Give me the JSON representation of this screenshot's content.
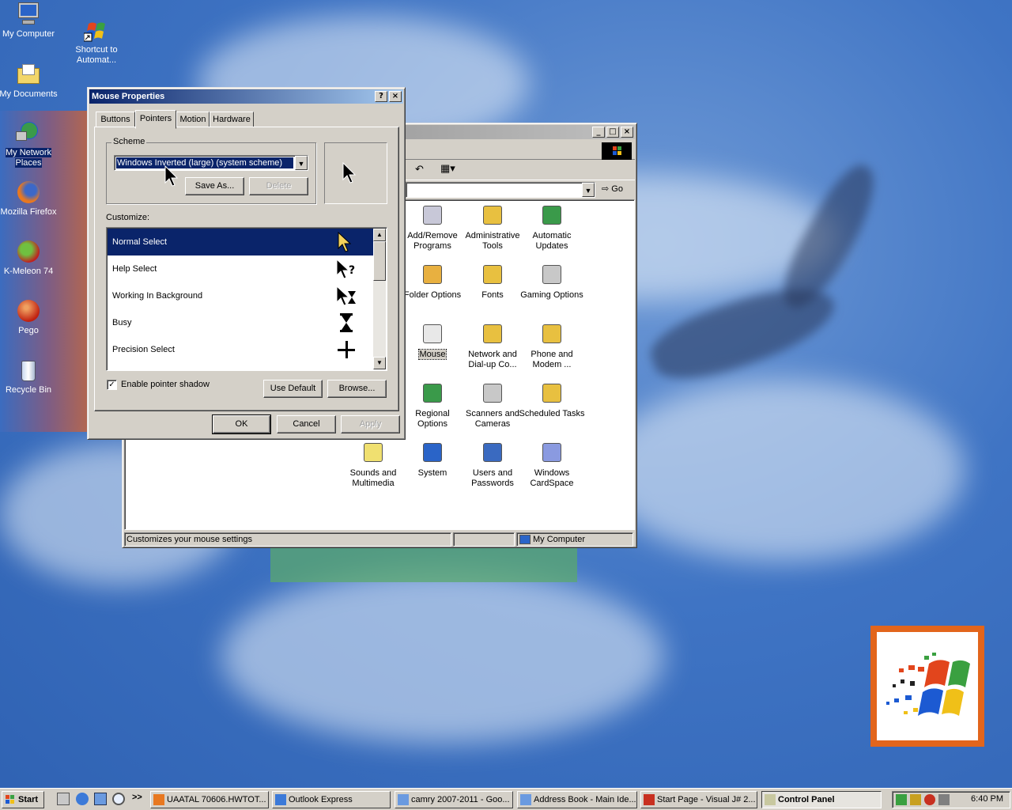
{
  "desktop": {
    "icons": [
      {
        "label": "My Computer",
        "icon": "my-computer-icon"
      },
      {
        "label": "Shortcut to Automat...",
        "icon": "windows-update-shortcut-icon"
      },
      {
        "label": "My Documents",
        "icon": "my-documents-icon"
      },
      {
        "label": "My Network Places",
        "icon": "network-places-icon"
      },
      {
        "label": "Mozilla Firefox",
        "icon": "firefox-icon"
      },
      {
        "label": "K-Meleon 74",
        "icon": "k-meleon-icon"
      },
      {
        "label": "Pego",
        "icon": "pego-icon"
      },
      {
        "label": "Recycle Bin",
        "icon": "recycle-bin-icon"
      }
    ]
  },
  "mouse_dialog": {
    "title": "Mouse Properties",
    "help_btn": "?",
    "close_btn": "×",
    "tabs": [
      "Buttons",
      "Pointers",
      "Motion",
      "Hardware"
    ],
    "active_tab": "Pointers",
    "scheme_label": "Scheme",
    "scheme_value": "Windows Inverted (large) (system scheme)",
    "save_as": "Save As...",
    "delete": "Delete",
    "customize_label": "Customize:",
    "pointers": [
      {
        "name": "Normal Select",
        "icon": "arrow-pointer-icon",
        "selected": true
      },
      {
        "name": "Help Select",
        "icon": "help-pointer-icon",
        "selected": false
      },
      {
        "name": "Working In Background",
        "icon": "working-pointer-icon",
        "selected": false
      },
      {
        "name": "Busy",
        "icon": "hourglass-icon",
        "selected": false
      },
      {
        "name": "Precision Select",
        "icon": "crosshair-icon",
        "selected": false
      }
    ],
    "shadow_label": "Enable pointer shadow",
    "shadow_checked": true,
    "use_default": "Use Default",
    "browse": "Browse...",
    "ok": "OK",
    "cancel": "Cancel",
    "apply": "Apply"
  },
  "control_panel": {
    "go": "Go",
    "status_text": "Customizes your mouse settings",
    "status_zone": "My Computer",
    "items": [
      {
        "label": "Add/Remove Programs",
        "icon": "add-remove-programs-icon"
      },
      {
        "label": "Administrative Tools",
        "icon": "administrative-tools-icon"
      },
      {
        "label": "Automatic Updates",
        "icon": "automatic-updates-icon"
      },
      {
        "label": "Folder Options",
        "icon": "folder-options-icon"
      },
      {
        "label": "Fonts",
        "icon": "fonts-icon"
      },
      {
        "label": "Gaming Options",
        "icon": "gaming-options-icon"
      },
      {
        "label": "Mouse",
        "icon": "mouse-icon"
      },
      {
        "label": "Network and Dial-up Co...",
        "icon": "network-dialup-icon"
      },
      {
        "label": "Phone and Modem ...",
        "icon": "phone-modem-icon"
      },
      {
        "label": "Regional Options",
        "icon": "regional-options-icon"
      },
      {
        "label": "Scanners and Cameras",
        "icon": "scanners-cameras-icon"
      },
      {
        "label": "Scheduled Tasks",
        "icon": "scheduled-tasks-icon"
      },
      {
        "label": "Sounds and Multimedia",
        "icon": "sounds-multimedia-icon"
      },
      {
        "label": "System",
        "icon": "system-icon"
      },
      {
        "label": "Users and Passwords",
        "icon": "users-passwords-icon"
      },
      {
        "label": "Windows CardSpace",
        "icon": "cardspace-icon"
      }
    ]
  },
  "taskbar": {
    "start": "Start",
    "quick_launch": ">>",
    "tasks": [
      {
        "label": "UAATAL 70606.HWTOT...",
        "active": false
      },
      {
        "label": "Outlook Express",
        "active": false
      },
      {
        "label": "camry 2007-2011 - Goo...",
        "active": false
      },
      {
        "label": "Address Book - Main Ide...",
        "active": false
      },
      {
        "label": "Start Page - Visual J# 2...",
        "active": false
      },
      {
        "label": "Control Panel",
        "active": true
      }
    ],
    "clock": "6:40 PM"
  },
  "colors": {
    "desktop_blue": "#3f74c4",
    "title_active": "#0a246a",
    "face": "#d4d0c8",
    "logo_orange": "#e2651c"
  }
}
